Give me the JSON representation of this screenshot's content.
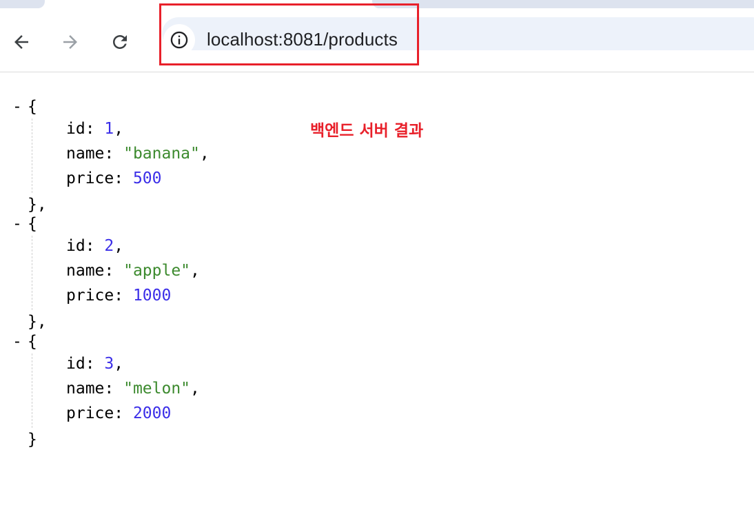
{
  "browser": {
    "url": "localhost:8081/products",
    "back_icon": "arrow-left-icon",
    "forward_icon": "arrow-right-icon",
    "reload_icon": "reload-icon",
    "site_info_icon": "info-circle-icon"
  },
  "annotation": {
    "text": "백엔드 서버 결과",
    "color": "#e8202a"
  },
  "json_view": {
    "collapse_symbol": "-",
    "open_brace": "{",
    "close_brace_comma": "},",
    "close_brace": "}",
    "keys": {
      "id": "id",
      "name": "name",
      "price": "price"
    },
    "products": [
      {
        "id": "1",
        "name": "\"banana\"",
        "price": "500"
      },
      {
        "id": "2",
        "name": "\"apple\"",
        "price": "1000"
      },
      {
        "id": "3",
        "name": "\"melon\"",
        "price": "2000"
      }
    ]
  },
  "colors": {
    "number": "#3b2ee8",
    "string": "#3c8a2e",
    "highlight": "#e8202a"
  }
}
